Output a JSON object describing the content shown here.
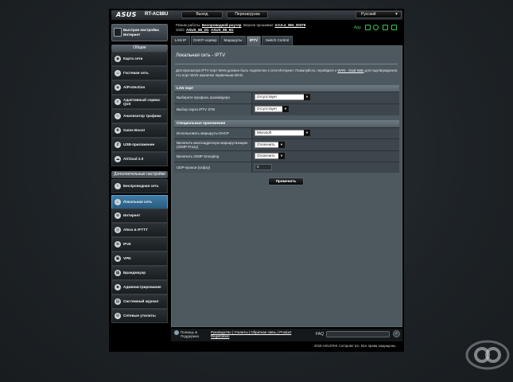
{
  "header": {
    "brand": "ASUS",
    "model": "RT-AC88U",
    "logout_label": "Выход",
    "reboot_label": "Перезагрузка",
    "language": "Русский"
  },
  "info": {
    "mode_label": "Режим работы:",
    "mode_value": "Беспроводной роутер",
    "firmware_label": "Версия прошивки:",
    "firmware_value": "3.0.0.4_384_20379",
    "ssid_label": "SSID:",
    "ssid_1": "ASUS_88_2G",
    "ssid_2": "ASUS_88_5G",
    "app_label": "App"
  },
  "sidebar": {
    "quick_setup": "Быстрая настройка Интернет",
    "general_header": "Общие",
    "general_items": [
      {
        "label": "Карта сети"
      },
      {
        "label": "Гостевая сеть"
      },
      {
        "label": "AiProtection"
      },
      {
        "label": "Адаптивный сервис QoS"
      },
      {
        "label": "Анализатор трафика"
      },
      {
        "label": "Game Boost"
      },
      {
        "label": "USB-приложение"
      },
      {
        "label": "AiCloud 2.0"
      }
    ],
    "advanced_header": "Дополнительные настройки",
    "advanced_items": [
      {
        "label": "Беспроводная сеть"
      },
      {
        "label": "Локальная сеть"
      },
      {
        "label": "Интернет"
      },
      {
        "label": "Alexa & IFTTT"
      },
      {
        "label": "IPv6"
      },
      {
        "label": "VPN"
      },
      {
        "label": "Брандмауэр"
      },
      {
        "label": "Администрирование"
      },
      {
        "label": "Системный журнал"
      },
      {
        "label": "Сетевые утилиты"
      }
    ]
  },
  "tabs": [
    {
      "label": "LAN IP"
    },
    {
      "label": "DHCP-сервер"
    },
    {
      "label": "Маршруты"
    },
    {
      "label": "IPTV"
    },
    {
      "label": "Switch Control"
    }
  ],
  "main": {
    "title": "Локальная сеть - IPTV",
    "description_1": "Для просмотра IPTV порт WAN должен быть подключен к сети Интернет. Пожалуйста, перейдите к",
    "description_link": "WAN - Dual Wan",
    "description_2": "для подтверждения, что порт WAN назначен первичным WAN.",
    "lan_port_header": "LAN порт",
    "lan_rows": [
      {
        "label": "Выберите профиль провайдера",
        "value": "Отсутствует"
      },
      {
        "label": "Выбор порта IPTV STB",
        "value": "Отсутствует"
      }
    ],
    "special_header": "Специальные приложения",
    "special_rows": [
      {
        "label": "Использовать маршруты DHCP",
        "value": "Microsoft"
      },
      {
        "label": "Включить многоадресную маршрутизацию (IGMP Proxy)",
        "value": "Отключить"
      },
      {
        "label": "Включить IGMP Snooping",
        "value": "Отключить"
      },
      {
        "label": "UDP-прокси (Udpxy)",
        "value": "0"
      }
    ],
    "apply_label": "Применить"
  },
  "footer": {
    "help_line1": "Помощь &",
    "help_line2": "Поддержка",
    "links_line1": "Руководство | Утилиты | Обратная связь | Product",
    "links_line2": "Registration",
    "faq_label": "FAQ",
    "copyright": "2018 ASUSTeK Computer Inc. Все права защищены."
  },
  "colors": {
    "active_nav": "#3e7da6",
    "status_green": "#39c651",
    "content_bg": "#4d585f"
  }
}
